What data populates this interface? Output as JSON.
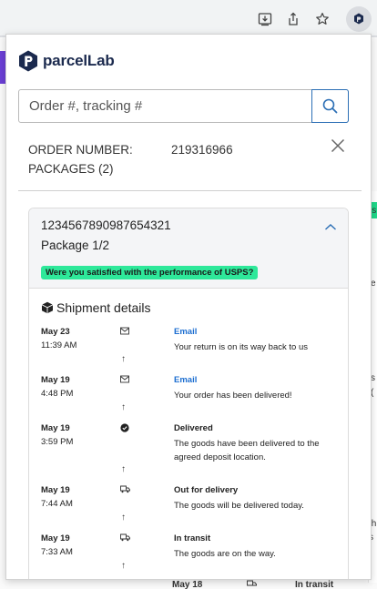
{
  "browser": {
    "extension_icon": "parcellab-icon"
  },
  "background": {
    "right_fragments": [
      "ls",
      "e",
      "s",
      "(",
      "th",
      "s"
    ],
    "bottom_row": {
      "date": "May 18",
      "status": "In transit"
    }
  },
  "app": {
    "brand": "parcelLab",
    "search": {
      "placeholder": "Order #, tracking #",
      "value": ""
    },
    "order": {
      "number_label": "ORDER NUMBER:",
      "number": "219316966",
      "packages_label": "PACKAGES (2)"
    },
    "package": {
      "tracking_number": "1234567890987654321",
      "label": "Package 1/2",
      "survey_prompt": "Were you satisfied with the performance of USPS?",
      "details_title": "Shipment details"
    },
    "events": [
      {
        "date": "May 23",
        "time": "11:39 AM",
        "icon": "envelope-icon",
        "title": "Email",
        "is_link": true,
        "description": "Your return is on its way back to us"
      },
      {
        "date": "May 19",
        "time": "4:48 PM",
        "icon": "envelope-icon",
        "title": "Email",
        "is_link": true,
        "description": "Your order has been delivered!"
      },
      {
        "date": "May 19",
        "time": "3:59 PM",
        "icon": "check-circle-icon",
        "title": "Delivered",
        "is_link": false,
        "description": "The goods have been delivered to the agreed deposit location."
      },
      {
        "date": "May 19",
        "time": "7:44 AM",
        "icon": "truck-icon",
        "title": "Out for delivery",
        "is_link": false,
        "description": "The goods will be delivered today."
      },
      {
        "date": "May 19",
        "time": "7:33 AM",
        "icon": "truck-icon",
        "title": "In transit",
        "is_link": false,
        "description": "The goods are on the way."
      }
    ],
    "colors": {
      "accent": "#2c6fb5",
      "link": "#1e6fd1",
      "survey_bg": "#2ee89a",
      "brand_dark": "#1b2a4e"
    }
  }
}
